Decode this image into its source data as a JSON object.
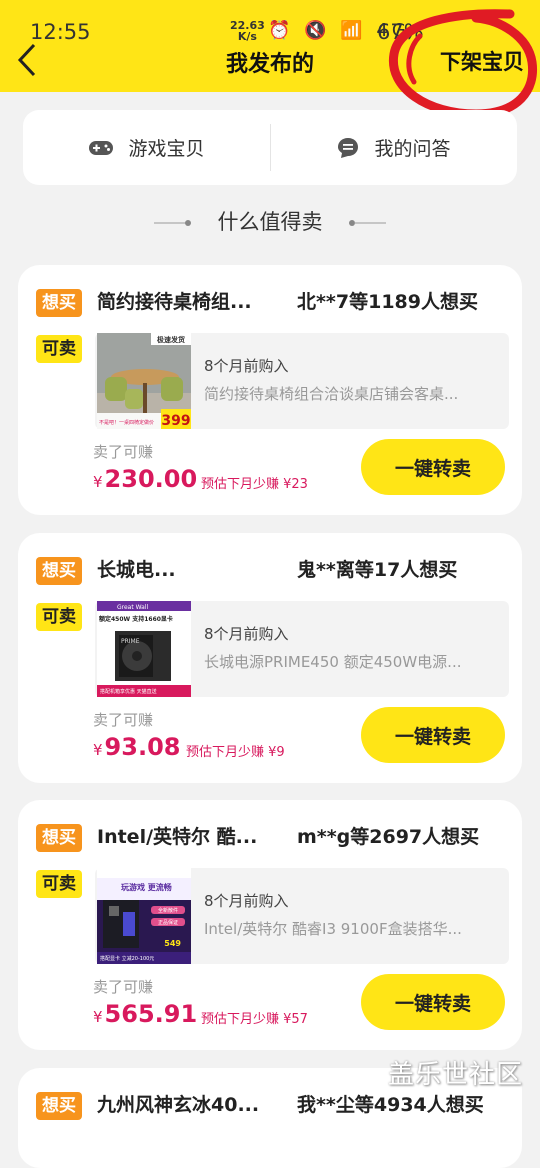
{
  "status_bar": {
    "time": "12:55",
    "net_speed": "22.63",
    "net_unit": "K/s",
    "icons": "⏰ 🔇 📶 4G",
    "battery": "67%"
  },
  "header": {
    "title": "我发布的",
    "action": "下架宝贝"
  },
  "tabs": [
    {
      "label": "游戏宝贝",
      "icon": "gamepad-icon"
    },
    {
      "label": "我的问答",
      "icon": "chat-icon"
    }
  ],
  "section_title": "什么值得卖",
  "tag_labels": {
    "want": "想买",
    "sell": "可卖"
  },
  "earn_label": "卖了可赚",
  "currency": "¥",
  "sell_button_label": "一键转卖",
  "items": [
    {
      "title": "简约接待桌椅组...",
      "interest": "北**7等1189人想买",
      "purchase_time": "8个月前购入",
      "desc": "简约接待桌椅组合洽谈桌店铺会客桌...",
      "price": "230.00",
      "estimate": "预估下月少赚 ¥23"
    },
    {
      "title": "长城电...",
      "interest": "鬼**离等17人想买",
      "purchase_time": "8个月前购入",
      "desc": "长城电源PRIME450 额定450W电源...",
      "price": "93.08",
      "estimate": "预估下月少赚 ¥9"
    },
    {
      "title": "Intel/英特尔 酷...",
      "interest": "m**g等2697人想买",
      "purchase_time": "8个月前购入",
      "desc": "Intel/英特尔 酷睿I3 9100F盒装搭华...",
      "price": "565.91",
      "estimate": "预估下月少赚 ¥57"
    },
    {
      "title": "九州风神玄冰40...",
      "interest": "我**尘等4934人想买"
    }
  ],
  "thumbs": {
    "item0": {
      "badge": "极速发货",
      "price": "399",
      "caption": "不是吧！一桌四椅定做价"
    },
    "item1": {
      "brand": "Great Wall",
      "headline": "额定450W 支持1660显卡",
      "model": "PRIME",
      "footer": "搭配机箱享优惠  天猫直送"
    },
    "item2": {
      "headline": "玩游戏 更流畅",
      "tag1": "全新散件",
      "tag2": "正品保证",
      "price": "549",
      "footer": "搭配显卡 立减20-100元"
    }
  },
  "watermark": "盖乐世社区",
  "colors": {
    "accent_yellow": "#ffe516",
    "tag_orange": "#f7941d",
    "price_pink": "#d8195d",
    "scribble_red": "#e01b24"
  }
}
